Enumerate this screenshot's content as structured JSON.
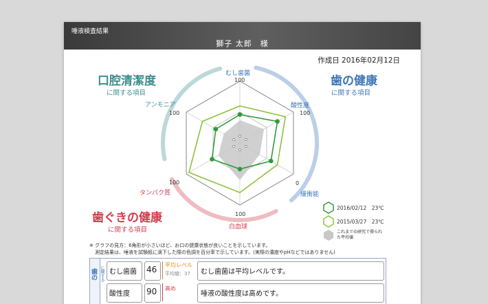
{
  "header": {
    "title": "唾液検査結果",
    "patient": "獅子 太郎　様"
  },
  "meta": {
    "date_label": "作成日 2016年02月12日"
  },
  "categories": {
    "mouth": {
      "title": "口腔清潔度",
      "sub": "に関する項目"
    },
    "teeth": {
      "title": "歯の健康",
      "sub": "に関する項目"
    },
    "gums": {
      "title": "歯ぐきの健康",
      "sub": "に関する項目"
    }
  },
  "colors": {
    "teeth": "#3d76b8",
    "mouth": "#3f8e8f",
    "gums": "#d23c4c",
    "series_1": "#2f9a3a",
    "series_2": "#8fc13d",
    "average": "#c8c8c8"
  },
  "axes": {
    "top": {
      "label": "むし歯菌",
      "max": "100"
    },
    "upper_right": {
      "label": "酸性度",
      "max": "100"
    },
    "lower_right": {
      "label": "緩衝能",
      "max": "0"
    },
    "bottom": {
      "label": "白血球",
      "max": "100"
    },
    "lower_left": {
      "label": "タンパク質",
      "max": "100"
    },
    "upper_left": {
      "label": "アンモニア",
      "max": "100"
    }
  },
  "chart_data": {
    "type": "radar",
    "axes": [
      "むし歯菌",
      "酸性度",
      "緩衝能",
      "白血球",
      "タンパク質",
      "アンモニア"
    ],
    "range": [
      0,
      100
    ],
    "series": [
      {
        "name": "2016/02/12　23℃",
        "values": [
          46,
          70,
          58,
          42,
          52,
          45
        ]
      },
      {
        "name": "2015/03/27　23℃",
        "values": [
          60,
          85,
          70,
          80,
          95,
          70
        ]
      },
      {
        "name": "これまでの研究で得られた平均値",
        "values": [
          37,
          45,
          37,
          60,
          40,
          30
        ]
      }
    ]
  },
  "legend": {
    "s1": "2016/02/12　23℃",
    "s2": "2015/03/27　23℃",
    "avg": "これまでの研究で得られた平均値"
  },
  "notes": {
    "line1": "※ グラフの見方：6角形が小さいほど、お口の健康状態が良いことを示しています。",
    "line2": "測定結果は、唾液を試験紙に滴下した際の色調を百分率で示しています。(実際の濃度やpHなどではありません)"
  },
  "results": {
    "side_label": "歯の",
    "side_small": "に関する",
    "rows": [
      {
        "item": "むし歯菌",
        "score": "46",
        "level": "平均レベル",
        "avg": "平均値：37",
        "comment": "むし歯菌は平均レベルです。"
      },
      {
        "item": "酸性度",
        "score": "90",
        "level": "高め",
        "avg": "",
        "comment": "唾液の酸性度は高めです。"
      }
    ]
  }
}
